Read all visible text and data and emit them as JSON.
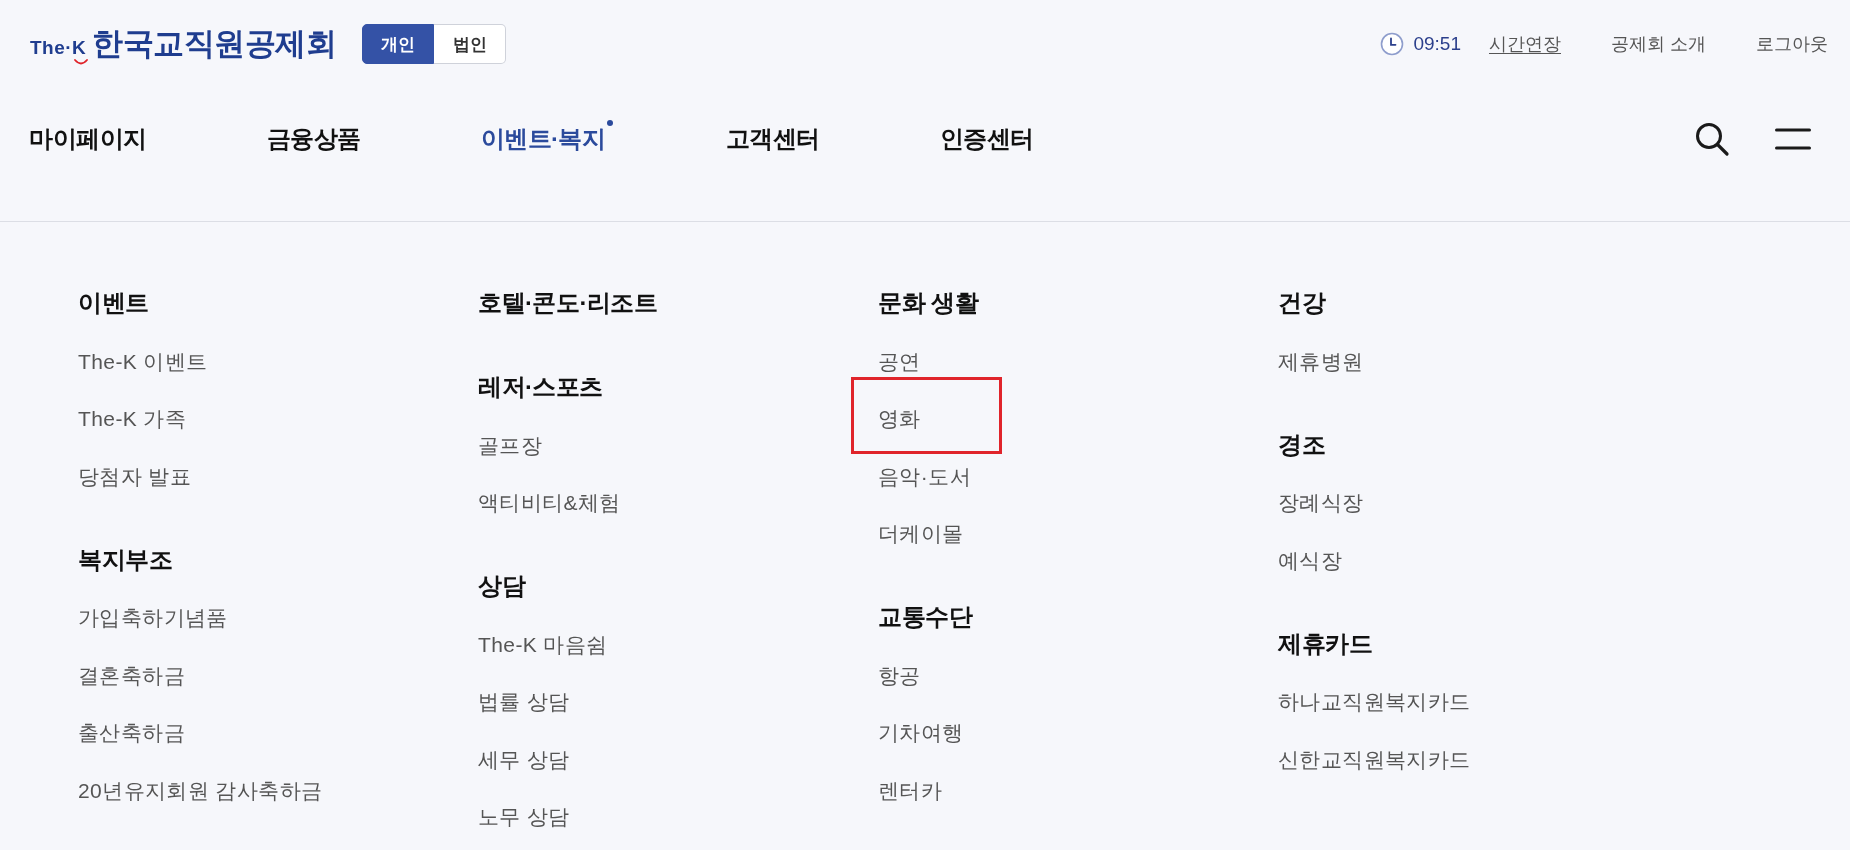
{
  "header": {
    "logo": {
      "prefix": "The·K",
      "name": "한국교직원공제회"
    },
    "member_type_tabs": [
      {
        "label": "개인",
        "selected": true
      },
      {
        "label": "법인",
        "selected": false
      }
    ],
    "session": {
      "time": "09:51",
      "extend_label": "시간연장"
    },
    "util_links": [
      "공제회 소개",
      "로그아웃"
    ]
  },
  "nav": {
    "items": [
      {
        "label": "마이페이지",
        "selected": false
      },
      {
        "label": "금융상품",
        "selected": false
      },
      {
        "label": "이벤트·복지",
        "selected": true
      },
      {
        "label": "고객센터",
        "selected": false
      },
      {
        "label": "인증센터",
        "selected": false
      }
    ]
  },
  "mega_menu": {
    "columns": [
      {
        "groups": [
          {
            "heading": "이벤트",
            "items": [
              {
                "label": "The-K 이벤트",
                "highlighted": false
              },
              {
                "label": "The-K 가족",
                "highlighted": false
              },
              {
                "label": "당첨자 발표",
                "highlighted": false
              }
            ]
          },
          {
            "heading": "복지부조",
            "items": [
              {
                "label": "가입축하기념품",
                "highlighted": false
              },
              {
                "label": "결혼축하금",
                "highlighted": false
              },
              {
                "label": "출산축하금",
                "highlighted": false
              },
              {
                "label": "20년유지회원 감사축하금",
                "highlighted": false
              }
            ]
          }
        ]
      },
      {
        "groups": [
          {
            "heading": "호텔·콘도·리조트"
          },
          {
            "heading": "레저·스포츠",
            "items": [
              {
                "label": "골프장",
                "highlighted": false
              },
              {
                "label": "액티비티&체험",
                "highlighted": false
              }
            ]
          },
          {
            "heading": "상담",
            "items": [
              {
                "label": "The-K 마음쉼",
                "highlighted": false
              },
              {
                "label": "법률 상담",
                "highlighted": false
              },
              {
                "label": "세무 상담",
                "highlighted": false
              },
              {
                "label": "노무 상담",
                "highlighted": false
              }
            ]
          }
        ]
      },
      {
        "groups": [
          {
            "heading": "문화 생활",
            "items": [
              {
                "label": "공연",
                "highlighted": false
              },
              {
                "label": "영화",
                "highlighted": true
              },
              {
                "label": "음악·도서",
                "highlighted": false
              },
              {
                "label": "더케이몰",
                "highlighted": false
              }
            ]
          },
          {
            "heading": "교통수단",
            "items": [
              {
                "label": "항공",
                "highlighted": false
              },
              {
                "label": "기차여행",
                "highlighted": false
              },
              {
                "label": "렌터카",
                "highlighted": false
              }
            ]
          }
        ]
      },
      {
        "groups": [
          {
            "heading": "건강",
            "items": [
              {
                "label": "제휴병원",
                "highlighted": false
              }
            ]
          },
          {
            "heading": "경조",
            "items": [
              {
                "label": "장례식장",
                "highlighted": false
              },
              {
                "label": "예식장",
                "highlighted": false
              }
            ]
          },
          {
            "heading": "제휴카드",
            "items": [
              {
                "label": "하나교직원복지카드",
                "highlighted": false
              },
              {
                "label": "신한교직원복지카드",
                "highlighted": false
              }
            ]
          }
        ]
      }
    ]
  }
}
